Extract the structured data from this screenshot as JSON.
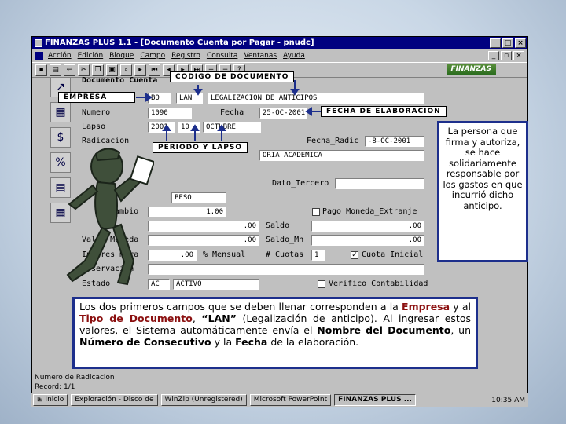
{
  "window": {
    "title": "FINANZAS PLUS 1.1 - [Documento Cuenta por Pagar - pnudc]",
    "logo": "FINANZAS"
  },
  "menu": [
    "Acción",
    "Edición",
    "Bloque",
    "Campo",
    "Registro",
    "Consulta",
    "Ventanas",
    "Ayuda"
  ],
  "form": {
    "header_label": "Documento Cuenta",
    "empresa_value": "BO",
    "tipo_value": "LAN",
    "tipo_desc": "LEGALIZACION DE ANTICIPOS",
    "numero_label": "Numero",
    "numero_value": "1090",
    "fecha_label": "Fecha",
    "fecha_value": "25-OC-2001",
    "lapso_label": "Lapso",
    "lapso_year": "2001",
    "lapso_month": "10",
    "lapso_desc": "OCTUBRE",
    "radicacion_label": "Radicacion",
    "fecha_radic_label": "Fecha_Radic",
    "fecha_radic_value": "-8-OC-2001",
    "beneficiario_desc": "ORIA ACADEMICA",
    "dato_tercero_label": "Dato_Tercero",
    "moneda_value": "PESO",
    "cambio_label": "Cambio",
    "cambio_value": "1.00",
    "pago_moneda_label": "Pago Moneda_Extranje",
    "valor_value": ".00",
    "saldo_label": "Saldo",
    "saldo_value": ".00",
    "valor_moneda_label": "Valor Moneda",
    "valor_moneda_value": ".00",
    "saldo_mn_label": "Saldo_Mn",
    "saldo_mn_value": ".00",
    "interes_label": "Interes mora",
    "interes_value": ".00",
    "interes_unit": "% Mensual",
    "cuotas_label": "# Cuotas",
    "cuotas_value": "1",
    "cuota_inicial_label": "Cuota Inicial",
    "observacion_label": "Observacion",
    "estado_label": "Estado",
    "estado_code": "AC",
    "estado_value": "ACTIVO",
    "verificado_label": "Verifico Contabilidad"
  },
  "callouts": {
    "codigo": "CODIGO DE DOCUMENTO",
    "empresa": "EMPRESA",
    "fecha": "FECHA DE ELABORACION",
    "periodo": "PERIODO Y LAPSO"
  },
  "status": {
    "line1": "Numero de Radicacion",
    "line2": "Record: 1/1"
  },
  "taskbar": {
    "start": "Inicio",
    "tasks": [
      "Exploración - Disco de",
      "WinZip (Unregistered)",
      "Microsoft PowerPoint",
      "FINANZAS PLUS ..."
    ],
    "clock": "10:35 AM"
  },
  "notes": {
    "side": "La persona que firma y autoriza, se hace solidariamente responsable por los gastos en que incurrió dicho anticipo.",
    "bottom": {
      "p1": "Los dos primeros campos que se deben llenar corresponden a la ",
      "empresa": "Empresa",
      "p2": " y al ",
      "tipo": "Tipo de Documento",
      "p3": ", ",
      "lan": "“LAN”",
      "p4": " (Legalización de anticipo). Al ingresar estos valores, el Sistema automáticamente envía el ",
      "nombre": "Nombre del Documento",
      "p5": ", un ",
      "numero": "Número de Consecutivo",
      "p6": " y la ",
      "fecha": "Fecha",
      "p7": " de la elaboración."
    }
  }
}
